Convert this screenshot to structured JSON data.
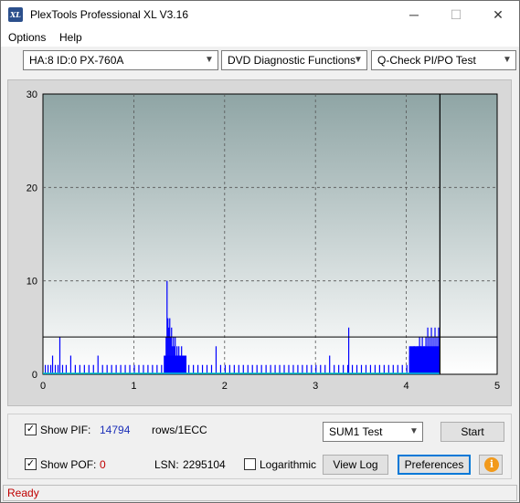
{
  "app": {
    "title": "PlexTools Professional XL V3.16",
    "icon_text": "XL"
  },
  "window_controls": {
    "minimize": "─",
    "maximize": "☐",
    "close": "✕"
  },
  "menu": {
    "options": "Options",
    "help": "Help"
  },
  "toolbar": {
    "drive": "HA:8 ID:0  PX-760A",
    "function": "DVD Diagnostic Functions",
    "test": "Q-Check PI/PO Test"
  },
  "chart_data": {
    "type": "bar",
    "xlim": [
      0,
      5
    ],
    "ylim": [
      0,
      30
    ],
    "x_ticks": [
      "0",
      "1",
      "2",
      "3",
      "4",
      "5"
    ],
    "y_ticks": [
      "0",
      "10",
      "20",
      "30"
    ],
    "grid": true,
    "threshold_line": 4,
    "end_marker_x": 4.37,
    "colors": {
      "bars": "#0000ff",
      "pof": "#00c8c8",
      "threshold": "#000000"
    },
    "spikes": [
      [
        0.02,
        1
      ],
      [
        0.05,
        1
      ],
      [
        0.08,
        1
      ],
      [
        0.1,
        2
      ],
      [
        0.13,
        1
      ],
      [
        0.16,
        1
      ],
      [
        0.18,
        4
      ],
      [
        0.21,
        1
      ],
      [
        0.25,
        1
      ],
      [
        0.3,
        2
      ],
      [
        0.35,
        1
      ],
      [
        0.4,
        1
      ],
      [
        0.45,
        1
      ],
      [
        0.5,
        1
      ],
      [
        0.55,
        1
      ],
      [
        0.6,
        2
      ],
      [
        0.65,
        1
      ],
      [
        0.7,
        1
      ],
      [
        0.75,
        1
      ],
      [
        0.8,
        1
      ],
      [
        0.85,
        1
      ],
      [
        0.9,
        1
      ],
      [
        0.95,
        1
      ],
      [
        1.0,
        1
      ],
      [
        1.05,
        1
      ],
      [
        1.1,
        1
      ],
      [
        1.15,
        1
      ],
      [
        1.2,
        1
      ],
      [
        1.25,
        1
      ],
      [
        1.3,
        1
      ],
      [
        1.35,
        4
      ],
      [
        1.36,
        10
      ],
      [
        1.37,
        6
      ],
      [
        1.38,
        5
      ],
      [
        1.39,
        6
      ],
      [
        1.4,
        4
      ],
      [
        1.41,
        5
      ],
      [
        1.42,
        3
      ],
      [
        1.43,
        4
      ],
      [
        1.44,
        3
      ],
      [
        1.45,
        4
      ],
      [
        1.46,
        2
      ],
      [
        1.47,
        3
      ],
      [
        1.48,
        2
      ],
      [
        1.49,
        3
      ],
      [
        1.5,
        2
      ],
      [
        1.52,
        3
      ],
      [
        1.54,
        2
      ],
      [
        1.56,
        1
      ],
      [
        1.6,
        1
      ],
      [
        1.65,
        1
      ],
      [
        1.7,
        1
      ],
      [
        1.75,
        1
      ],
      [
        1.8,
        1
      ],
      [
        1.85,
        1
      ],
      [
        1.9,
        3
      ],
      [
        1.95,
        1
      ],
      [
        2.0,
        1
      ],
      [
        2.05,
        1
      ],
      [
        2.1,
        1
      ],
      [
        2.15,
        1
      ],
      [
        2.2,
        1
      ],
      [
        2.25,
        1
      ],
      [
        2.3,
        1
      ],
      [
        2.35,
        1
      ],
      [
        2.4,
        1
      ],
      [
        2.45,
        1
      ],
      [
        2.5,
        1
      ],
      [
        2.55,
        1
      ],
      [
        2.6,
        1
      ],
      [
        2.65,
        1
      ],
      [
        2.7,
        1
      ],
      [
        2.75,
        1
      ],
      [
        2.8,
        1
      ],
      [
        2.85,
        1
      ],
      [
        2.9,
        1
      ],
      [
        2.95,
        1
      ],
      [
        3.0,
        1
      ],
      [
        3.05,
        1
      ],
      [
        3.1,
        1
      ],
      [
        3.15,
        2
      ],
      [
        3.2,
        1
      ],
      [
        3.25,
        1
      ],
      [
        3.3,
        1
      ],
      [
        3.35,
        1
      ],
      [
        3.36,
        5
      ],
      [
        3.4,
        1
      ],
      [
        3.45,
        1
      ],
      [
        3.5,
        1
      ],
      [
        3.55,
        1
      ],
      [
        3.6,
        1
      ],
      [
        3.65,
        1
      ],
      [
        3.7,
        1
      ],
      [
        3.75,
        1
      ],
      [
        3.8,
        1
      ],
      [
        3.85,
        1
      ],
      [
        3.9,
        1
      ],
      [
        3.95,
        1
      ],
      [
        4.0,
        1
      ],
      [
        4.03,
        2
      ],
      [
        4.05,
        1
      ],
      [
        4.07,
        2
      ],
      [
        4.08,
        3
      ],
      [
        4.1,
        2
      ],
      [
        4.12,
        3
      ],
      [
        4.14,
        4
      ],
      [
        4.15,
        3
      ],
      [
        4.17,
        4
      ],
      [
        4.19,
        3
      ],
      [
        4.21,
        4
      ],
      [
        4.23,
        5
      ],
      [
        4.25,
        4
      ],
      [
        4.27,
        5
      ],
      [
        4.29,
        4
      ],
      [
        4.31,
        5
      ],
      [
        4.33,
        4
      ],
      [
        4.35,
        5
      ],
      [
        4.36,
        4
      ]
    ]
  },
  "controls": {
    "show_pif_label": "Show PIF:",
    "pif_value": "14794",
    "pif_unit": "rows/1ECC",
    "show_pof_label": "Show POF:",
    "pof_value": "0",
    "lsn_label": "LSN:",
    "lsn_value": "2295104",
    "logarithmic_label": "Logarithmic",
    "sum_select": "SUM1 Test",
    "start_button": "Start",
    "view_log_button": "View Log",
    "preferences_button": "Preferences"
  },
  "status": {
    "text": "Ready"
  }
}
